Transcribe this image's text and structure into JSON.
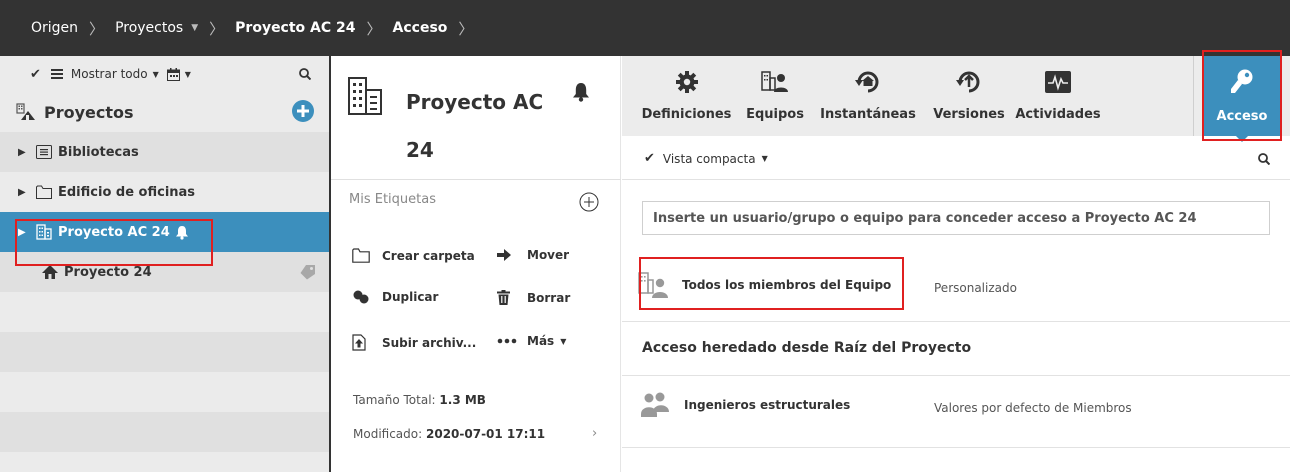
{
  "breadcrumb": {
    "items": [
      {
        "label": "Origen",
        "bold": false
      },
      {
        "label": "Proyectos",
        "bold": false,
        "dropdown": true
      },
      {
        "label": "Proyecto AC 24",
        "bold": true
      },
      {
        "label": "Acceso",
        "bold": true
      }
    ]
  },
  "sidebar": {
    "toolbar": {
      "show_all_label": "Mostrar todo"
    },
    "title": "Proyectos",
    "items": [
      {
        "label": "Bibliotecas",
        "icon": "library-folder-icon"
      },
      {
        "label": "Edificio de oficinas",
        "icon": "folder-icon"
      },
      {
        "label": "Proyecto AC 24",
        "icon": "building-icon",
        "selected": true,
        "notification": true
      },
      {
        "label": "Proyecto 24",
        "icon": "home-icon",
        "tag": true
      }
    ]
  },
  "details": {
    "title": "Proyecto AC 24",
    "tags_label": "Mis Etiquetas",
    "actions": {
      "create_folder": "Crear carpeta",
      "move": "Mover",
      "duplicate": "Duplicar",
      "delete": "Borrar",
      "upload": "Subir archiv...",
      "more": "Más"
    },
    "size_label": "Tamaño Total:",
    "size_value": "1.3 MB",
    "modified_label": "Modificado:",
    "modified_value": "2020-07-01 17:11"
  },
  "tabs": [
    {
      "label": "Definiciones",
      "icon": "gear-icon"
    },
    {
      "label": "Equipos",
      "icon": "team-icon"
    },
    {
      "label": "Instantáneas",
      "icon": "snapshot-icon"
    },
    {
      "label": "Versiones",
      "icon": "versions-icon"
    },
    {
      "label": "Actividades",
      "icon": "activity-icon"
    },
    {
      "label": "Acceso",
      "icon": "key-icon",
      "active": true
    }
  ],
  "access": {
    "view_label": "Vista compacta",
    "input_placeholder": "Inserte un usuario/grupo o equipo para conceder acceso a Proyecto AC 24",
    "entries": [
      {
        "name": "Todos los miembros del Equipo",
        "permission": "Personalizado"
      }
    ],
    "inherited_title": "Acceso heredado desde Raíz del Proyecto",
    "inherited_entries": [
      {
        "name": "Ingenieros estructurales",
        "permission": "Valores por defecto de Miembros"
      }
    ]
  },
  "colors": {
    "accent": "#3c8fbd",
    "topbar": "#333333",
    "highlight_box": "#e02020"
  }
}
